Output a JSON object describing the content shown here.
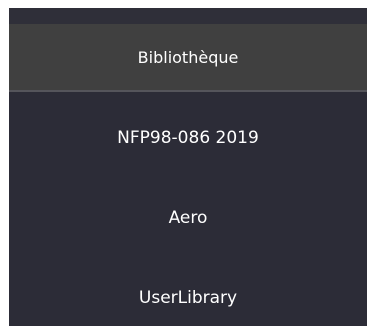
{
  "header": {
    "title": "Bibliothèque"
  },
  "library_list": {
    "items": [
      {
        "label": "NFP98-086 2019"
      },
      {
        "label": "Aero"
      },
      {
        "label": "UserLibrary"
      }
    ]
  }
}
